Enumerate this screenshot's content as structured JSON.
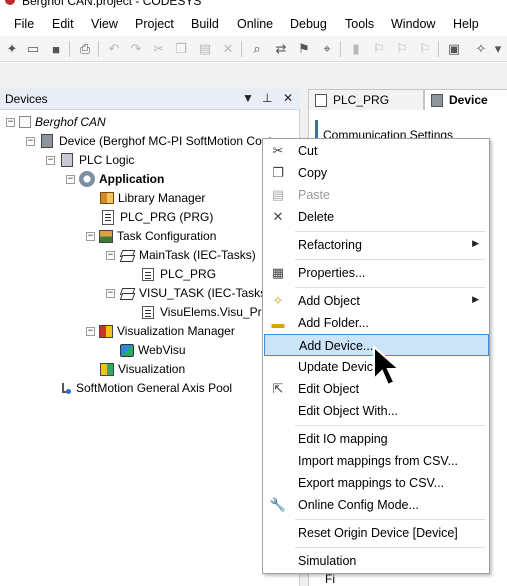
{
  "window": {
    "title": "Berghof CAN.project - CODESYS"
  },
  "menu": [
    "File",
    "Edit",
    "View",
    "Project",
    "Build",
    "Online",
    "Debug",
    "Tools",
    "Window",
    "Help"
  ],
  "devices_panel": {
    "title": "Devices",
    "pin": "⊥",
    "close": "✕",
    "dropdown": "▼"
  },
  "tree": {
    "root": "Berghof CAN",
    "device": "Device (Berghof MC-PI SoftMotion Contro",
    "plc_logic": "PLC Logic",
    "application": "Application",
    "library_manager": "Library Manager",
    "plc_prg": "PLC_PRG (PRG)",
    "task_config": "Task Configuration",
    "main_task": "MainTask (IEC-Tasks)",
    "main_task_child": "PLC_PRG",
    "visu_task": "VISU_TASK (IEC-Tasks)",
    "visu_task_child": "VisuElems.Visu_Prg",
    "visu_manager": "Visualization Manager",
    "webvisu": "WebVisu",
    "visualization": "Visualization",
    "axis_pool": "SoftMotion General Axis Pool"
  },
  "editor": {
    "tabs": [
      "PLC_PRG",
      "Device"
    ],
    "section_title": "Communication Settings",
    "footer": "Fi"
  },
  "context_menu": {
    "cut": "Cut",
    "copy": "Copy",
    "paste": "Paste",
    "delete": "Delete",
    "refactoring": "Refactoring",
    "properties": "Properties...",
    "add_object": "Add Object",
    "add_folder": "Add Folder...",
    "add_device": "Add Device...",
    "update_device": "Update Device...",
    "edit_object": "Edit Object",
    "edit_object_with": "Edit Object With...",
    "edit_io_mapping": "Edit IO mapping",
    "import_mappings": "Import mappings from CSV...",
    "export_mappings": "Export mappings to CSV...",
    "online_config": "Online Config Mode...",
    "reset_origin": "Reset Origin Device [Device]",
    "simulation": "Simulation"
  },
  "colors": {
    "highlight_bg": "#cce4f7",
    "highlight_border": "#3d8ee6",
    "panel_header": "#e9eef6"
  }
}
